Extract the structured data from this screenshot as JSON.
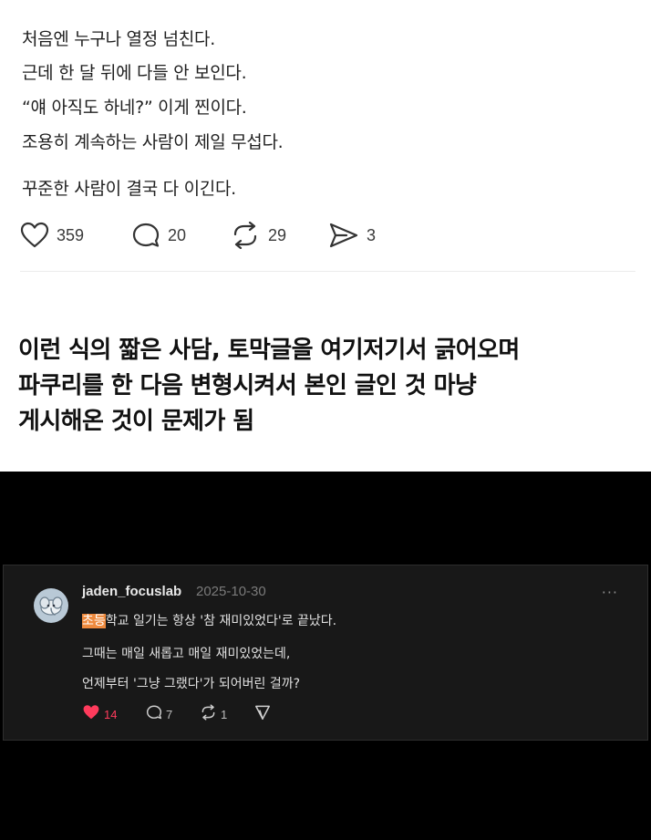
{
  "post": {
    "lines": [
      "처음엔 누구나 열정 넘친다.",
      "근데 한 달 뒤에 다들 안 보인다.",
      "“얘 아직도 하네?” 이게 찐이다.",
      "조용히 계속하는 사람이 제일 무섭다.",
      "꾸준한 사람이 결국 다 이긴다."
    ],
    "actions": {
      "likes": "359",
      "comments": "20",
      "reposts": "29",
      "shares": "3"
    }
  },
  "caption": {
    "lines": [
      "이런 식의 짧은 사담, 토막글을 여기저기서 긁어오며",
      "파쿠리를 한 다음 변형시켜서 본인 글인 것 마냥",
      "게시해온 것이 문제가 됨"
    ]
  },
  "comment": {
    "username": "jaden_focuslab",
    "date": "2025-10-30",
    "more": "···",
    "line1_highlight": "초등",
    "line1_rest": "학교 일기는 항상 '참 재미있었다'로 끝났다.",
    "line2": "그때는 매일 새롭고 매일 재미있었는데,",
    "line3": "언제부터 '그냥 그랬다'가 되어버린 걸까?",
    "actions": {
      "likes": "14",
      "comments": "7",
      "reposts": "1"
    },
    "colors": {
      "highlight": "#ee8a3e",
      "liked": "#ff3b5c"
    }
  }
}
